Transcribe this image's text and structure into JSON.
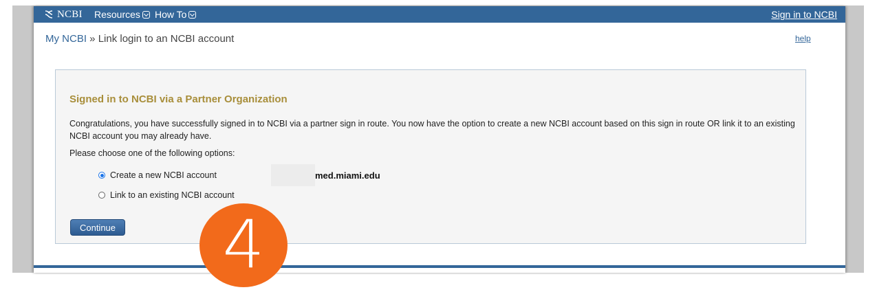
{
  "topbar": {
    "logo_text": "NCBI",
    "menu": [
      {
        "label": "Resources",
        "icon": "chevron-down-icon"
      },
      {
        "label": "How To",
        "icon": "chevron-down-icon"
      }
    ],
    "signin_label": "Sign in to NCBI",
    "accent_color": "#336699"
  },
  "breadcrumb": {
    "root": "My NCBI",
    "separator": "»",
    "current": "Link login to an NCBI account"
  },
  "help_label": "help",
  "panel": {
    "title": "Signed in to NCBI via a Partner Organization",
    "title_color": "#a88e3a",
    "description": "Congratulations, you have successfully signed in to NCBI via a partner sign in route. You now have the option to create a new NCBI account based on this sign in route OR link it to an existing NCBI account you may already have.",
    "prompt": "Please choose one of the following options:",
    "options": [
      {
        "label": "Create a new NCBI account",
        "selected": true
      },
      {
        "label": "Link to an existing NCBI account",
        "selected": false
      }
    ],
    "account_id": "med.miami.edu",
    "continue_label": "Continue"
  },
  "step_badge": {
    "number": "4",
    "color": "#f26a1b"
  }
}
